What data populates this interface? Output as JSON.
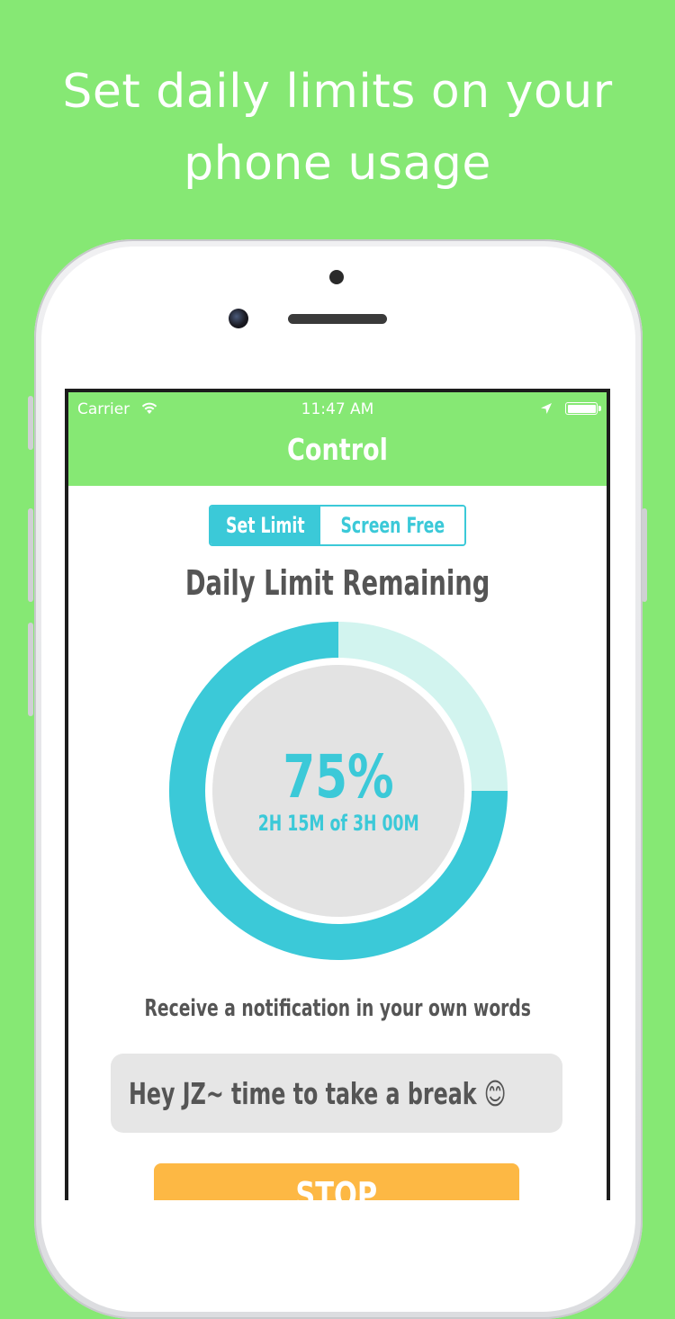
{
  "headline": {
    "line1": "Set daily limits on your",
    "line2": "phone usage"
  },
  "status_bar": {
    "carrier": "Carrier",
    "time": "11:47 AM",
    "icons": [
      "wifi-icon",
      "location-icon",
      "battery-icon"
    ]
  },
  "nav": {
    "title": "Control"
  },
  "segmented": {
    "options": [
      "Set Limit",
      "Screen Free"
    ],
    "selected": "Set Limit"
  },
  "limit": {
    "title": "Daily Limit Remaining",
    "percent_label": "75%",
    "remaining_fraction": 0.75,
    "detail": "2H 15M of 3H 00M"
  },
  "notification": {
    "label": "Receive a notification in your own words",
    "message": "Hey JZ~ time to take a break 😊"
  },
  "actions": {
    "stop_label": "STOP"
  },
  "colors": {
    "background": "#86e874",
    "accent": "#3bc9d8",
    "accent_light": "#d2f4ef",
    "stop_button": "#fdb844"
  }
}
